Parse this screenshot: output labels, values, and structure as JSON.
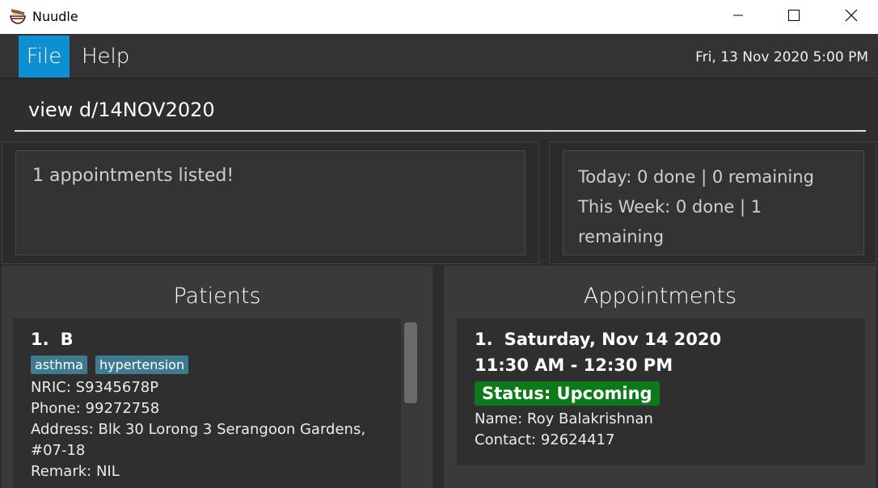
{
  "window": {
    "title": "Nuudle",
    "app_icon": "noodle-bowl-icon",
    "minimize_icon": "minimize-icon",
    "maximize_icon": "maximize-icon",
    "close_icon": "close-icon"
  },
  "menu": {
    "items": [
      {
        "label": "File",
        "active": true
      },
      {
        "label": "Help",
        "active": false
      }
    ],
    "datetime": "Fri, 13 Nov 2020 5:00 PM"
  },
  "command": {
    "value": "view d/14NOV2020"
  },
  "result": {
    "message": "1 appointments listed!",
    "stats": {
      "today": "Today: 0 done | 0 remaining",
      "week": "This Week: 0 done | 1 remaining"
    }
  },
  "patients": {
    "title": "Patients",
    "items": [
      {
        "index": "1.",
        "name": "B",
        "tags": [
          "asthma",
          "hypertension"
        ],
        "nric": "NRIC: S9345678P",
        "phone": "Phone: 99272758",
        "address_line1": "Address: Blk 30 Lorong 3 Serangoon Gardens,",
        "address_line2": "#07-18",
        "remark": "Remark: NIL"
      }
    ]
  },
  "appointments": {
    "title": "Appointments",
    "items": [
      {
        "index": "1.",
        "date": "Saturday, Nov 14 2020",
        "time": "11:30 AM - 12:30 PM",
        "status": "Status: Upcoming",
        "name": "Name: Roy Balakrishnan",
        "contact": "Contact: 92624417"
      }
    ]
  },
  "colors": {
    "accent": "#0e8fd1",
    "tag": "#3e7b91",
    "status_upcoming": "#0c7a1a",
    "background": "#2b2b2b"
  }
}
